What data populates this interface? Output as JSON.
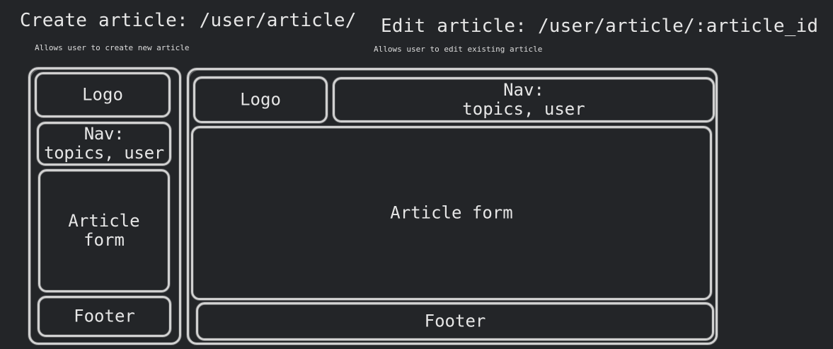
{
  "create": {
    "title": "Create article: /user/article/",
    "subtitle": "Allows user to create new article",
    "blocks": {
      "logo": "Logo",
      "nav": "Nav:\ntopics, user",
      "article_form": "Article\nform",
      "footer": "Footer"
    }
  },
  "edit": {
    "title": "Edit article: /user/article/:article_id",
    "subtitle": "Allows user to edit existing article",
    "blocks": {
      "logo": "Logo",
      "nav": "Nav:\ntopics, user",
      "article_form": "Article form",
      "footer": "Footer"
    }
  },
  "colors": {
    "background": "#232528",
    "stroke": "#d2d2d2",
    "text": "#e6e6e6"
  }
}
